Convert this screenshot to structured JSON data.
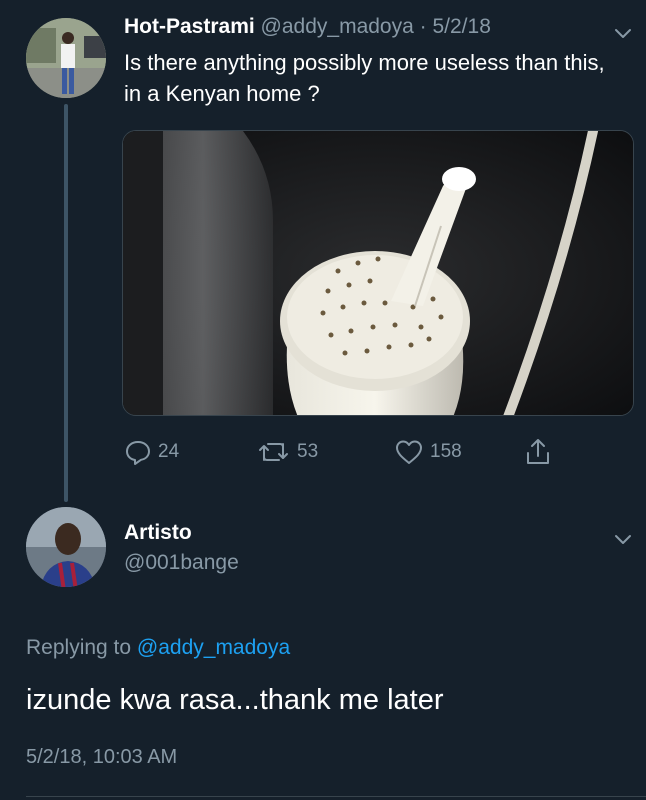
{
  "colors": {
    "background": "#15202b",
    "primary_text": "#ffffff",
    "secondary_text": "#8899a6",
    "link": "#1da1f2",
    "thread_line": "#3d5466"
  },
  "original_tweet": {
    "display_name": "Hot-Pastrami",
    "handle": "@addy_madoya",
    "separator": "·",
    "date": "5/2/18",
    "text": "Is there anything possibly more useless than this, in a Kenyan home ?",
    "media_icon": "photo-shower-head",
    "actions": {
      "reply": {
        "icon": "comment-icon",
        "count": "24"
      },
      "retweet": {
        "icon": "retweet-icon",
        "count": "53"
      },
      "like": {
        "icon": "heart-icon",
        "count": "158"
      },
      "share": {
        "icon": "share-icon"
      }
    },
    "menu_icon": "chevron-down-icon"
  },
  "reply_tweet": {
    "display_name": "Artisto",
    "handle": "@001bange",
    "replying_prefix": "Replying to",
    "replying_to": "@addy_madoya",
    "text": "izunde kwa rasa...thank me later",
    "timestamp": "5/2/18, 10:03 AM",
    "menu_icon": "chevron-down-icon"
  }
}
